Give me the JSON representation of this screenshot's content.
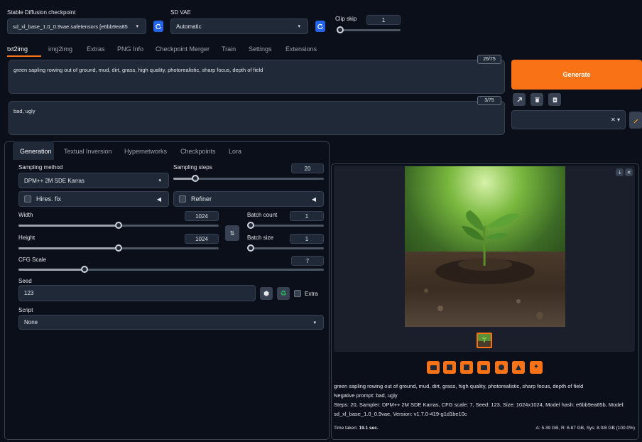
{
  "top": {
    "checkpoint_label": "Stable Diffusion checkpoint",
    "checkpoint_value": "sd_xl_base_1.0_0.9vae.safetensors [e6bb9ea85",
    "vae_label": "SD VAE",
    "vae_value": "Automatic",
    "clip_skip_label": "Clip skip",
    "clip_skip_value": "1"
  },
  "main_tabs": [
    "txt2img",
    "img2img",
    "Extras",
    "PNG Info",
    "Checkpoint Merger",
    "Train",
    "Settings",
    "Extensions"
  ],
  "prompt": {
    "positive": "green sapling rowing out of ground, mud, dirt, grass, high quality, photorealistic, sharp focus, depth of field",
    "positive_counter": "26/75",
    "negative": "bad, ugly",
    "negative_counter": "3/75"
  },
  "generate_label": "Generate",
  "styles_clear": "✕ ▾",
  "sub_tabs": [
    "Generation",
    "Textual Inversion",
    "Hypernetworks",
    "Checkpoints",
    "Lora"
  ],
  "generation": {
    "sampling_method_label": "Sampling method",
    "sampling_method_value": "DPM++ 2M SDE Karras",
    "sampling_steps_label": "Sampling steps",
    "sampling_steps_value": "20",
    "sampling_steps_fraction": 0.13,
    "hires_label": "Hires. fix",
    "refiner_label": "Refiner",
    "width_label": "Width",
    "width_value": "1024",
    "width_fraction": 0.5,
    "height_label": "Height",
    "height_value": "1024",
    "height_fraction": 0.5,
    "batch_count_label": "Batch count",
    "batch_count_value": "1",
    "batch_size_label": "Batch size",
    "batch_size_value": "1",
    "cfg_label": "CFG Scale",
    "cfg_value": "7",
    "cfg_fraction": 0.21,
    "seed_label": "Seed",
    "seed_value": "123",
    "extra_label": "Extra",
    "script_label": "Script",
    "script_value": "None"
  },
  "output": {
    "prompt_text": "green sapling rowing out of ground, mud, dirt, grass, high quality, photorealistic, sharp focus, depth of field",
    "negative_text": "Negative prompt: bad, ugly",
    "params_line1": "Steps: 20, Sampler: DPM++ 2M SDE Karras, CFG scale: 7, Seed: 123, Size: 1024x1024, Model hash: e6bb9ea85b, Model:",
    "params_line2": "sd_xl_base_1.0_0.9vae, Version: v1.7.0-419-g1d1be10c",
    "time_label": "Time taken:",
    "time_value": "19.1 sec.",
    "vram": "A: 5.39 GB, R: 6.87 GB, Sys: 8.0/8 GB (100.0%)"
  },
  "colors": {
    "accent": "#f97316",
    "blue": "#2563eb",
    "background": "#0b0f19"
  }
}
